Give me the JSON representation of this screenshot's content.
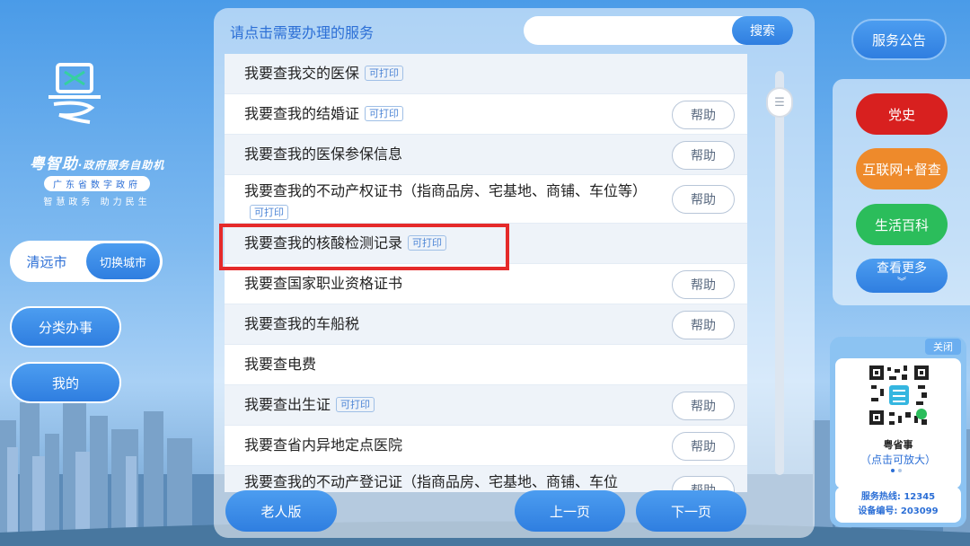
{
  "brand": {
    "name": "粤智助",
    "tagline": "·政府服务自助机",
    "org": "广东省数字政府",
    "slogan": "智慧政务 助力民生"
  },
  "city": {
    "name": "清远市",
    "switch_label": "切换城市"
  },
  "left_nav": {
    "category_label": "分类办事",
    "mine_label": "我的"
  },
  "center": {
    "title": "请点击需要办理的服务",
    "search": {
      "placeholder": "",
      "button_label": "搜索"
    },
    "print_tag": "可打印",
    "help_label": "帮助",
    "items": [
      {
        "label": "我要查我交的医保",
        "printable": true,
        "help": false
      },
      {
        "label": "我要查我的结婚证",
        "printable": true,
        "help": true
      },
      {
        "label": "我要查我的医保参保信息",
        "printable": false,
        "help": true
      },
      {
        "label": "我要查我的不动产权证书（指商品房、宅基地、商铺、车位等）",
        "printable": true,
        "help": true
      },
      {
        "label": "我要查我的核酸检测记录",
        "printable": true,
        "help": false,
        "highlighted": true
      },
      {
        "label": "我要查国家职业资格证书",
        "printable": false,
        "help": true
      },
      {
        "label": "我要查我的车船税",
        "printable": false,
        "help": true
      },
      {
        "label": "我要查电费",
        "printable": false,
        "help": false
      },
      {
        "label": "我要查出生证",
        "printable": true,
        "help": true
      },
      {
        "label": "我要查省内异地定点医院",
        "printable": false,
        "help": true
      },
      {
        "label": "我要查我的不动产登记证（指商品房、宅基地、商铺、车位",
        "printable": false,
        "help": true
      }
    ],
    "elderly_label": "老人版",
    "prev_label": "上一页",
    "next_label": "下一页"
  },
  "right": {
    "notice_label": "服务公告",
    "quick": [
      {
        "label": "党史",
        "color": "#d8201f"
      },
      {
        "label": "互联网+督查",
        "color": "#ee8a2b"
      },
      {
        "label": "生活百科",
        "color": "#2bbd5b"
      }
    ],
    "more_label": "查看更多",
    "qr": {
      "close_label": "关闭",
      "name": "粤省事",
      "hint": "（点击可放大）",
      "hotline": "服务热线: 12345",
      "device": "设备编号: 203099"
    }
  },
  "colors": {
    "accent": "#2f7ee0",
    "highlight": "#e52a2a"
  }
}
